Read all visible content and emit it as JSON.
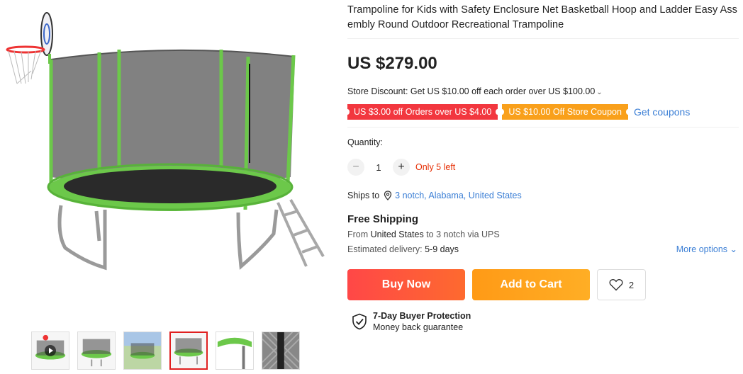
{
  "product": {
    "title": "Trampoline for Kids with Safety Enclosure Net Basketball Hoop and Ladder Easy Assembly Round Outdoor Recreational Trampoline",
    "title_line1": "Trampoline for Kids with Safety Enclosure Net Basketball Hoop and Ladder Easy Ass",
    "title_line2": "embly Round Outdoor Recreational Trampoline",
    "price": "US $279.00"
  },
  "store_discount": {
    "text": "Store Discount: Get US $10.00 off each order over US $100.00",
    "chevron": "chevron-down-icon"
  },
  "coupons": [
    {
      "label": "US $3.00 off Orders over US $4.00",
      "color": "#f2373f"
    },
    {
      "label": "US $10.00 Off Store Coupon",
      "color": "#f9a01b"
    }
  ],
  "get_coupons": "Get coupons",
  "quantity": {
    "label": "Quantity:",
    "value": "1",
    "minus": "−",
    "plus": "+",
    "stock": "Only 5 left"
  },
  "shipping": {
    "ships_to_label": "Ships to",
    "location": "3 notch, Alabama, United States",
    "free_label": "Free Shipping",
    "from_prefix": "From",
    "from_country": "United States",
    "to_text": "to 3 notch via UPS",
    "est_label": "Estimated delivery:",
    "est_days": "5-9 days",
    "more_options": "More options"
  },
  "actions": {
    "buy_now": "Buy Now",
    "add_to_cart": "Add to Cart",
    "wishlist_count": "2"
  },
  "protection": {
    "title": "7-Day Buyer Protection",
    "subtitle": "Money back guarantee"
  },
  "gallery": {
    "thumbnail_count": 6,
    "active_index": 3
  },
  "colors": {
    "accent_red": "#e62e04",
    "link_blue": "#3a7ed5",
    "buy_gradient": "#ff4747",
    "cart_gradient": "#ff9a16",
    "trampoline_green": "#6cc84a"
  }
}
